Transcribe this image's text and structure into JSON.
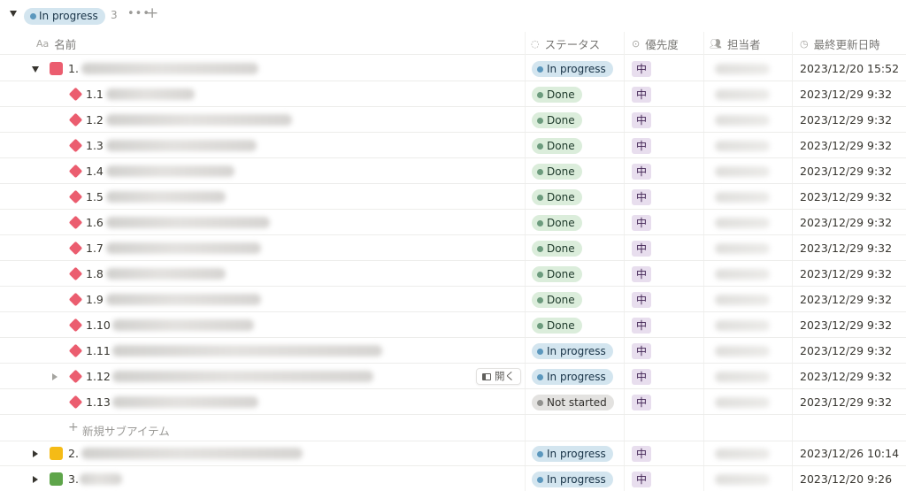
{
  "group": {
    "label": "In progress",
    "count": "3",
    "more_icon": "more-horizontal-icon",
    "add_icon": "plus-icon"
  },
  "columns": {
    "name": {
      "icon": "text-icon",
      "icon_text": "Aa",
      "label": "名前"
    },
    "status": {
      "icon": "status-icon",
      "label": "ステータス"
    },
    "priority": {
      "icon": "select-icon",
      "label": "優先度"
    },
    "assignee": {
      "icon": "people-icon",
      "label": "担当者"
    },
    "updated": {
      "icon": "clock-icon",
      "label": "最終更新日時"
    }
  },
  "colors": {
    "red": "#eb5d6f",
    "yellow": "#f5bb16",
    "green": "#5ea54a",
    "in_progress_bg": "#d3e5ef",
    "done_bg": "#dbeddb",
    "not_started_bg": "#e3e2e0",
    "priority_bg": "#e8deee"
  },
  "open_button": {
    "label": "開く",
    "icon": "peek-icon"
  },
  "new_subitem": {
    "label": "新規サブアイテム"
  },
  "rows": [
    {
      "prefix": "1.",
      "status": "In progress",
      "priority": "中",
      "updated": "2023/12/20 15:52"
    },
    {
      "prefix": "1.1",
      "status": "Done",
      "priority": "中",
      "updated": "2023/12/29 9:32"
    },
    {
      "prefix": "1.2",
      "status": "Done",
      "priority": "中",
      "updated": "2023/12/29 9:32"
    },
    {
      "prefix": "1.3",
      "status": "Done",
      "priority": "中",
      "updated": "2023/12/29 9:32"
    },
    {
      "prefix": "1.4",
      "status": "Done",
      "priority": "中",
      "updated": "2023/12/29 9:32"
    },
    {
      "prefix": "1.5",
      "status": "Done",
      "priority": "中",
      "updated": "2023/12/29 9:32"
    },
    {
      "prefix": "1.6",
      "status": "Done",
      "priority": "中",
      "updated": "2023/12/29 9:32"
    },
    {
      "prefix": "1.7",
      "status": "Done",
      "priority": "中",
      "updated": "2023/12/29 9:32"
    },
    {
      "prefix": "1.8",
      "status": "Done",
      "priority": "中",
      "updated": "2023/12/29 9:32"
    },
    {
      "prefix": "1.9",
      "status": "Done",
      "priority": "中",
      "updated": "2023/12/29 9:32"
    },
    {
      "prefix": "1.10",
      "status": "Done",
      "priority": "中",
      "updated": "2023/12/29 9:32"
    },
    {
      "prefix": "1.11",
      "status": "In progress",
      "priority": "中",
      "updated": "2023/12/29 9:32"
    },
    {
      "prefix": "1.12",
      "status": "In progress",
      "priority": "中",
      "updated": "2023/12/29 9:32"
    },
    {
      "prefix": "1.13",
      "status": "Not started",
      "priority": "中",
      "updated": "2023/12/29 9:32"
    },
    {
      "prefix": "2.",
      "status": "In progress",
      "priority": "中",
      "updated": "2023/12/26 10:14"
    },
    {
      "prefix": "3.",
      "status": "In progress",
      "priority": "中",
      "updated": "2023/12/20 9:26"
    }
  ]
}
